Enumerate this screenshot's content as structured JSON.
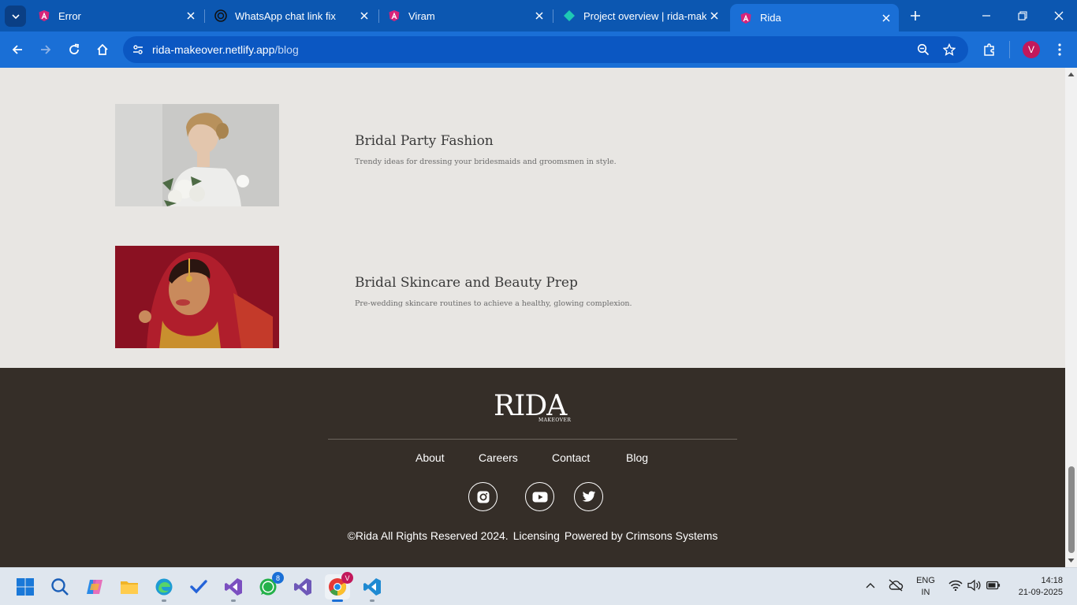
{
  "browser": {
    "tabs": [
      {
        "title": "Error",
        "icon": "angular-icon"
      },
      {
        "title": "WhatsApp chat link fix",
        "icon": "chatgpt-icon"
      },
      {
        "title": "Viram",
        "icon": "angular-icon"
      },
      {
        "title": "Project overview | rida-make",
        "icon": "firebase-icon"
      },
      {
        "title": "Rida",
        "icon": "angular-icon",
        "active": true
      }
    ],
    "url_host": "rida-makeover.netlify.app",
    "url_path": "/blog",
    "profile_initial": "V"
  },
  "posts": [
    {
      "title": "Bridal Party Fashion",
      "description": "Trendy ideas for dressing your bridesmaids and groomsmen in style."
    },
    {
      "title": "Bridal Skincare and Beauty Prep",
      "description": "Pre-wedding skincare routines to achieve a healthy, glowing complexion."
    }
  ],
  "footer": {
    "logo_main": "RIDA",
    "logo_sub": "MAKEOVER",
    "links": [
      "About",
      "Careers",
      "Contact",
      "Blog"
    ],
    "social": [
      "instagram-icon",
      "youtube-icon",
      "twitter-icon"
    ],
    "copyright": "©Rida All Rights Reserved 2024.",
    "licensing": "Licensing",
    "powered": "Powered by Crimsons Systems"
  },
  "taskbar": {
    "whatsapp_badge": "8",
    "chrome_badge": "V",
    "lang_line1": "ENG",
    "lang_line2": "IN",
    "time": "14:18",
    "date": "21-09-2025"
  },
  "colors": {
    "tab_bar": "#0c57b1",
    "toolbar": "#1a6fd6",
    "page_bg": "#e8e6e3",
    "footer_bg": "#352e28"
  }
}
